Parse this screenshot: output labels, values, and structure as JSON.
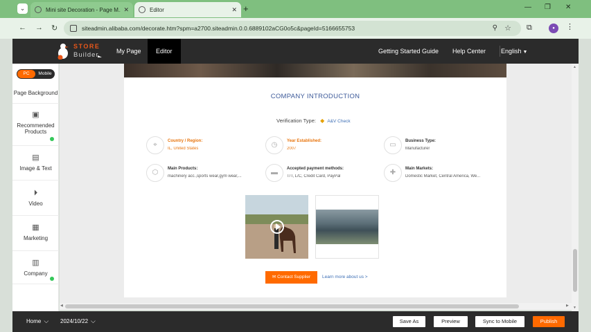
{
  "browser": {
    "tabs": [
      {
        "label": "Mini site Decoration - Page M..."
      },
      {
        "label": "Editor"
      }
    ],
    "url": "siteadmin.alibaba.com/decorate.htm?spm=a2700.siteadmin.0.0.6889102aCG0o5c&pageId=5166655753"
  },
  "app": {
    "logo_line1": "STORE",
    "logo_line2": "Builder",
    "nav_my_page": "My Page",
    "nav_editor": "Editor",
    "nav_getting_started": "Getting Started Guide",
    "nav_help": "Help Center",
    "nav_lang": "English"
  },
  "sidebar": {
    "toggle_pc": "PC",
    "toggle_mobile": "Mobile",
    "page_background": "Page Background",
    "items": [
      {
        "label": "Recommended Products",
        "icon": "product-icon"
      },
      {
        "label": "Image & Text",
        "icon": "image-text-icon"
      },
      {
        "label": "Video",
        "icon": "video-icon"
      },
      {
        "label": "Marketing",
        "icon": "marketing-icon"
      },
      {
        "label": "Company",
        "icon": "company-icon"
      }
    ]
  },
  "module": {
    "title": "COMPANY INTRODUCTION",
    "verification_label": "Verification Type:",
    "verification_value": "A&V Check",
    "info": [
      {
        "label": "Country / Region:",
        "value": "IL, United States"
      },
      {
        "label": "Year Established:",
        "value": "2007"
      },
      {
        "label": "Business Type:",
        "value": "Manufacturer"
      },
      {
        "label": "Main Products:",
        "value": "machinery acc.,sports wear,gym wear,..."
      },
      {
        "label": "Accepted payment methods:",
        "value": "T/T, L/C, Credit Card, PayPal"
      },
      {
        "label": "Main Markets:",
        "value": "Domestic Market, Central America, We..."
      }
    ],
    "contact_button": "Contact Supplier",
    "learn_more": "Learn more about us >"
  },
  "bottom": {
    "home": "Home",
    "date": "2024/10/22",
    "save_as": "Save As",
    "preview": "Preview",
    "sync": "Sync to Mobile",
    "publish": "Publish"
  },
  "colors": {
    "accent": "#ff6a00",
    "dark": "#2b2b2b",
    "link": "#3d6fb5",
    "browser_green": "#7fbf7f"
  }
}
